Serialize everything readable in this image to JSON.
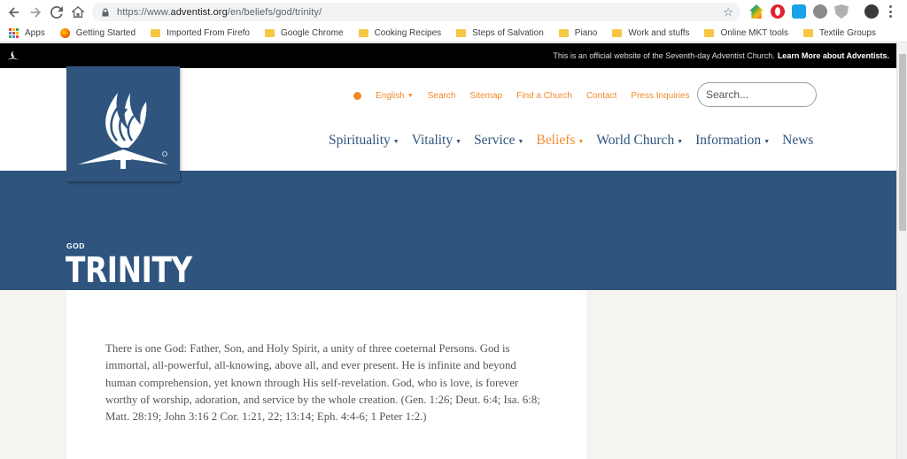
{
  "browser": {
    "url_prefix": "https://www.",
    "url_domain": "adventist.org",
    "url_path": "/en/beliefs/god/trinity/",
    "bookmarks": [
      {
        "label": "Apps",
        "icon": "apps-grid-icon"
      },
      {
        "label": "Getting Started",
        "icon": "firefox-icon"
      },
      {
        "label": "Imported From Firefo",
        "icon": "folder-icon"
      },
      {
        "label": "Google Chrome",
        "icon": "folder-icon"
      },
      {
        "label": "Cooking Recipes",
        "icon": "folder-icon"
      },
      {
        "label": "Steps of Salvation",
        "icon": "folder-icon"
      },
      {
        "label": "Piano",
        "icon": "folder-icon"
      },
      {
        "label": "Work and stuffs",
        "icon": "folder-icon"
      },
      {
        "label": "Online MKT tools",
        "icon": "folder-icon"
      },
      {
        "label": "Textile Groups",
        "icon": "folder-icon"
      }
    ]
  },
  "topbar": {
    "message": "This is an official website of the Seventh-day Adventist Church.",
    "link": "Learn More about Adventists."
  },
  "utility": {
    "language": "English",
    "links": [
      "Search",
      "Sitemap",
      "Find a Church",
      "Contact",
      "Press Inquiries"
    ],
    "search_placeholder": "Search..."
  },
  "nav": {
    "items": [
      {
        "label": "Spirituality",
        "dropdown": true
      },
      {
        "label": "Vitality",
        "dropdown": true
      },
      {
        "label": "Service",
        "dropdown": true
      },
      {
        "label": "Beliefs",
        "dropdown": true
      },
      {
        "label": "World Church",
        "dropdown": true
      },
      {
        "label": "Information",
        "dropdown": true
      },
      {
        "label": "News",
        "dropdown": false
      }
    ],
    "active": "Beliefs"
  },
  "hero": {
    "eyebrow": "GOD",
    "title": "TRINITY"
  },
  "content": {
    "paragraph": "There is one God: Father, Son, and Holy Spirit, a unity of three coeternal Persons. God is immortal, all-powerful, all-knowing, above all, and ever present. He is infinite and beyond human comprehension, yet known through His self-revelation. God, who is love, is forever worthy of worship, adoration, and service by the whole creation. (Gen. 1:26; Deut. 6:4; Isa. 6:8; Matt. 28:19; John 3:16 2 Cor. 1:21, 22; 13:14; Eph. 4:4-6; 1 Peter 1:2.)"
  },
  "colors": {
    "brand_blue": "#2f557f",
    "accent_orange": "#f08b2a",
    "page_bg": "#f5f4ef"
  }
}
